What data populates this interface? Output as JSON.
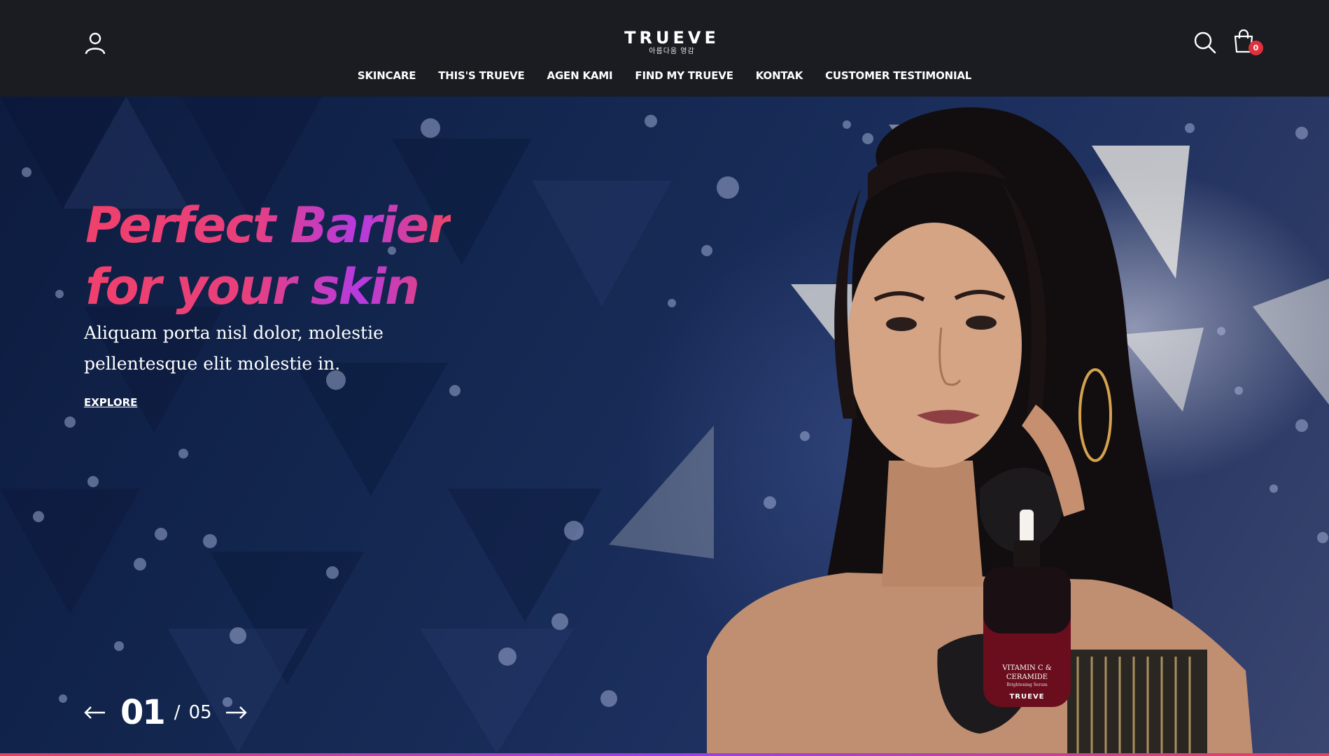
{
  "header": {
    "logo": {
      "word": "TRUEVE",
      "tagline": "아름다움 영감"
    },
    "icons": {
      "account": "user-icon",
      "search": "search-icon",
      "cart": "shopping-bag-icon"
    },
    "cart_count": "0",
    "nav": [
      {
        "label": "SKINCARE"
      },
      {
        "label": "THIS'S TRUEVE"
      },
      {
        "label": "AGEN KAMI"
      },
      {
        "label": "FIND MY TRUEVE"
      },
      {
        "label": "KONTAK"
      },
      {
        "label": "CUSTOMER TESTIMONIAL"
      }
    ]
  },
  "hero": {
    "title_line1": "Perfect Barier",
    "title_line2": "for your skin",
    "subtitle": "Aliquam porta nisl dolor, molestie pellentesque elit molestie in.",
    "cta": "EXPLORE",
    "product_label": {
      "name": "VITAMIN C & CERAMIDE",
      "type": "Brightening Serum",
      "brand": "TRUEVE"
    },
    "pager": {
      "current": "01",
      "separator": "/",
      "total": "05",
      "prev_icon": "arrow-left-icon",
      "next_icon": "arrow-right-icon"
    }
  },
  "colors": {
    "header_bg": "#1b1c22",
    "hero_bg": "#132750",
    "title_gradient_start": "#f0406c",
    "title_gradient_mid": "#b53ae0",
    "badge": "#e0303e"
  }
}
